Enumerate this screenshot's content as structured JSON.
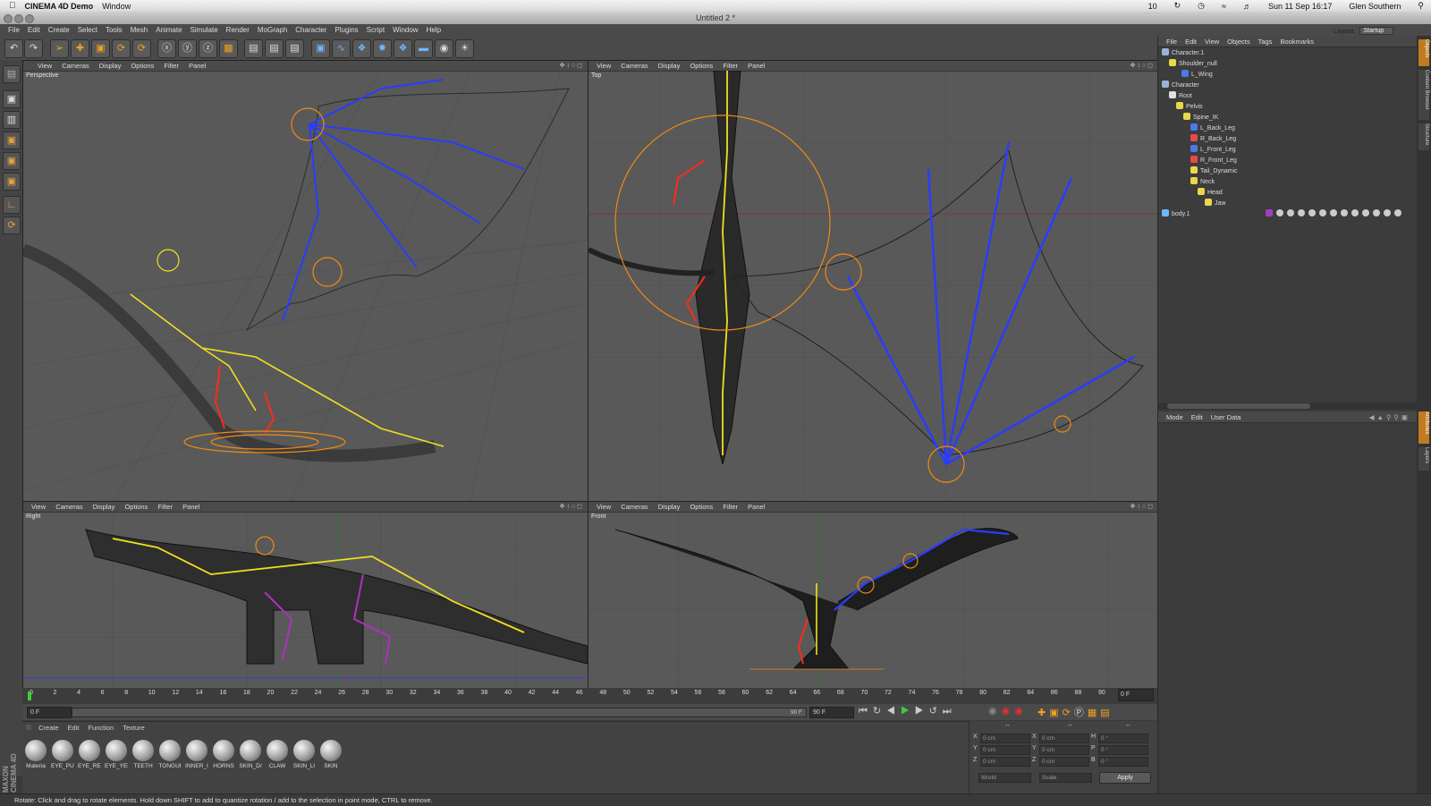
{
  "mac": {
    "app_name": "CINEMA 4D Demo",
    "menu": [
      "Window"
    ],
    "status_num": "10",
    "datetime": "Sun 11 Sep  16:17",
    "user": "Glen Southern"
  },
  "window": {
    "title": "Untitled 2 *"
  },
  "app_menu": [
    "File",
    "Edit",
    "Create",
    "Select",
    "Tools",
    "Mesh",
    "Animate",
    "Simulate",
    "Render",
    "MoGraph",
    "Character",
    "Plugins",
    "Script",
    "Window",
    "Help"
  ],
  "layout": {
    "label": "Layout:",
    "value": "Startup"
  },
  "viewport_menu": [
    "View",
    "Cameras",
    "Display",
    "Options",
    "Filter",
    "Panel"
  ],
  "viewports": {
    "perspective": "Perspective",
    "top": "Top",
    "right": "Right",
    "front": "Front"
  },
  "timeline": {
    "ticks": [
      "0",
      "2",
      "4",
      "6",
      "8",
      "10",
      "12",
      "14",
      "16",
      "18",
      "20",
      "22",
      "24",
      "26",
      "28",
      "30",
      "32",
      "34",
      "36",
      "38",
      "40",
      "42",
      "44",
      "46",
      "48",
      "50",
      "52",
      "54",
      "56",
      "58",
      "60",
      "62",
      "64",
      "66",
      "68",
      "70",
      "72",
      "74",
      "76",
      "78",
      "80",
      "82",
      "84",
      "86",
      "88",
      "90"
    ],
    "current_frame": "0 F",
    "start_frame": "0 F",
    "end_field": "90 F",
    "end_frame": "90 F",
    "range_end_label": "90 F"
  },
  "material_manager": {
    "menu": [
      "Create",
      "Edit",
      "Function",
      "Texture"
    ],
    "materials": [
      "Materia",
      "EYE_PUI",
      "EYE_REI",
      "EYE_YEI",
      "TEETH",
      "TONGUI",
      "INNER_I",
      "HORNS",
      "SKIN_D/",
      "CLAW",
      "SKIN_LI",
      "SKIN"
    ]
  },
  "coordinates": {
    "headers": [
      "--",
      "--",
      "--"
    ],
    "rows": [
      {
        "a": "X",
        "av": "0 cm",
        "b": "X",
        "bv": "0 cm",
        "c": "H",
        "cv": "0 °"
      },
      {
        "a": "Y",
        "av": "0 cm",
        "b": "Y",
        "bv": "0 cm",
        "c": "P",
        "cv": "0 °"
      },
      {
        "a": "Z",
        "av": "0 cm",
        "b": "Z",
        "bv": "0 cm",
        "c": "B",
        "cv": "0 °"
      }
    ],
    "world": "World",
    "scale": "Scale",
    "apply": "Apply"
  },
  "object_manager": {
    "menu": [
      "File",
      "Edit",
      "View",
      "Objects",
      "Tags",
      "Bookmarks"
    ],
    "objects": [
      {
        "name": "Character.1",
        "color": "#9ab4d8"
      },
      {
        "name": "Shoulder_null",
        "color": "#e8d84a"
      },
      {
        "name": "L_Wing",
        "color": "#4a7ae8"
      },
      {
        "name": "Character",
        "color": "#9ab4d8"
      },
      {
        "name": "Root",
        "color": "#e0e0e0"
      },
      {
        "name": "Pelvis",
        "color": "#e8d84a"
      },
      {
        "name": "Spine_IK",
        "color": "#e8d84a"
      },
      {
        "name": "L_Back_Leg",
        "color": "#4a7ae8"
      },
      {
        "name": "R_Back_Leg",
        "color": "#e84a4a"
      },
      {
        "name": "L_Front_Leg",
        "color": "#4a7ae8"
      },
      {
        "name": "R_Front_Leg",
        "color": "#e84a4a"
      },
      {
        "name": "Tail_Dynamic",
        "color": "#e8d84a"
      },
      {
        "name": "Neck",
        "color": "#e8d84a"
      },
      {
        "name": "Head",
        "color": "#e8d84a"
      },
      {
        "name": "Jaw",
        "color": "#e8d84a"
      },
      {
        "name": "body.1",
        "color": "#6fb6ff"
      }
    ]
  },
  "attribute_manager": {
    "menu": [
      "Mode",
      "Edit",
      "User Data"
    ]
  },
  "side_tabs": [
    "Objects",
    "Content Browser",
    "Structure",
    "Attributes",
    "Layers"
  ],
  "status_bar": "Rotate: Click and drag to rotate elements. Hold down SHIFT to add to quantize rotation / add to the selection in point mode, CTRL to remove.",
  "colors": {
    "bone_yellow": "#f0e020",
    "bone_blue": "#2a3cff",
    "bone_red": "#ff2a1a",
    "bone_magenta": "#b030c0",
    "ik_orange": "#f08a10"
  }
}
